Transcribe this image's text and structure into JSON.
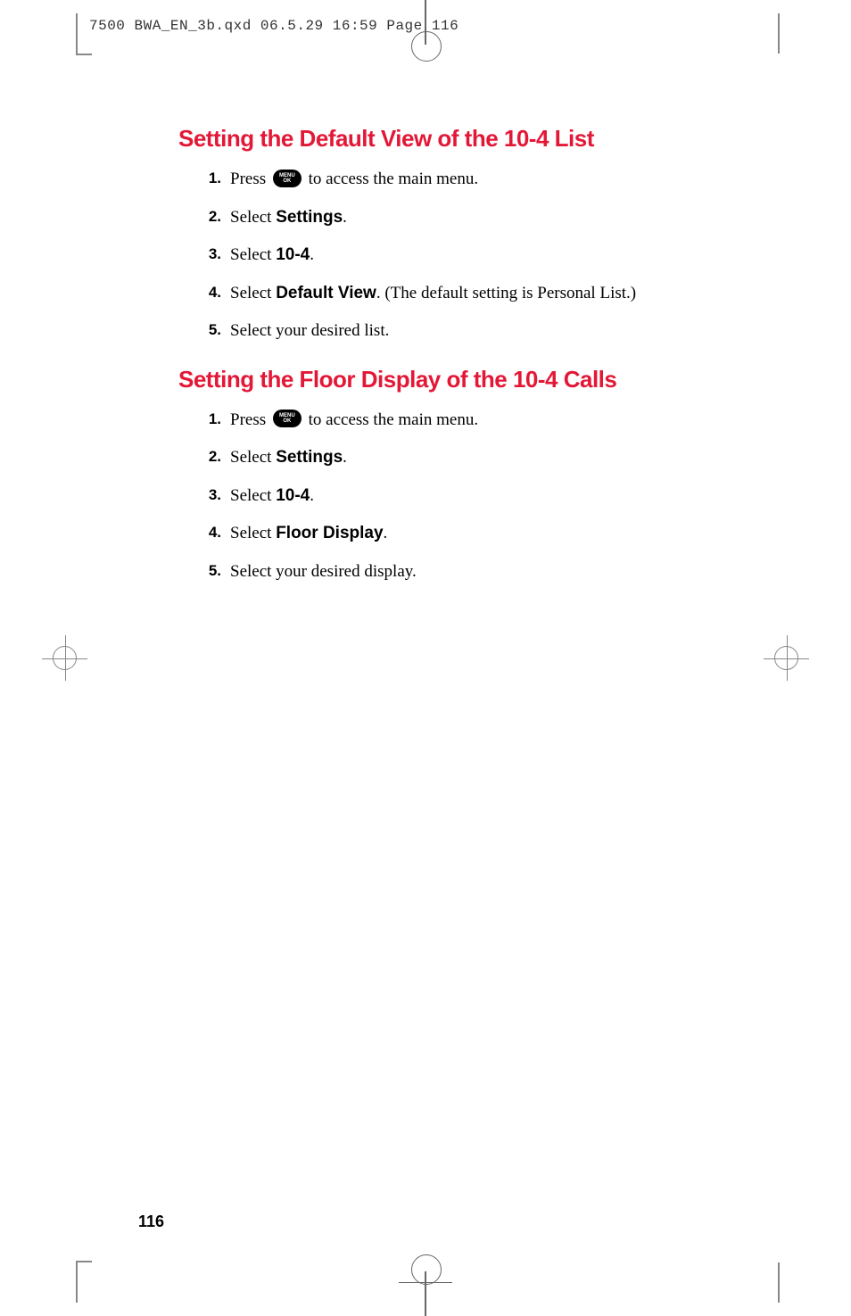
{
  "print_header": "7500 BWA_EN_3b.qxd  06.5.29  16:59  Page 116",
  "page_number": "116",
  "sections": [
    {
      "heading": "Setting the Default View of the 10-4 List",
      "steps": [
        {
          "number": "1.",
          "prefix": "Press ",
          "icon": "menu-ok",
          "suffix": " to access the main menu."
        },
        {
          "number": "2.",
          "prefix": "Select ",
          "bold": "Settings",
          "suffix": "."
        },
        {
          "number": "3.",
          "prefix": "Select ",
          "bold": "10-4",
          "suffix": "."
        },
        {
          "number": "4.",
          "prefix": "Select ",
          "bold": "Default View",
          "suffix": ". (The default setting is Personal List.)"
        },
        {
          "number": "5.",
          "prefix": "Select your desired list.",
          "bold": "",
          "suffix": ""
        }
      ]
    },
    {
      "heading": "Setting the Floor Display of the 10-4 Calls",
      "steps": [
        {
          "number": "1.",
          "prefix": "Press ",
          "icon": "menu-ok",
          "suffix": " to access the main menu."
        },
        {
          "number": "2.",
          "prefix": "Select ",
          "bold": "Settings",
          "suffix": "."
        },
        {
          "number": "3.",
          "prefix": "Select ",
          "bold": "10-4",
          "suffix": "."
        },
        {
          "number": "4.",
          "prefix": "Select ",
          "bold": "Floor Display",
          "suffix": "."
        },
        {
          "number": "5.",
          "prefix": "Select your desired display.",
          "bold": "",
          "suffix": ""
        }
      ]
    }
  ],
  "icon_label": "MENU\nOK"
}
